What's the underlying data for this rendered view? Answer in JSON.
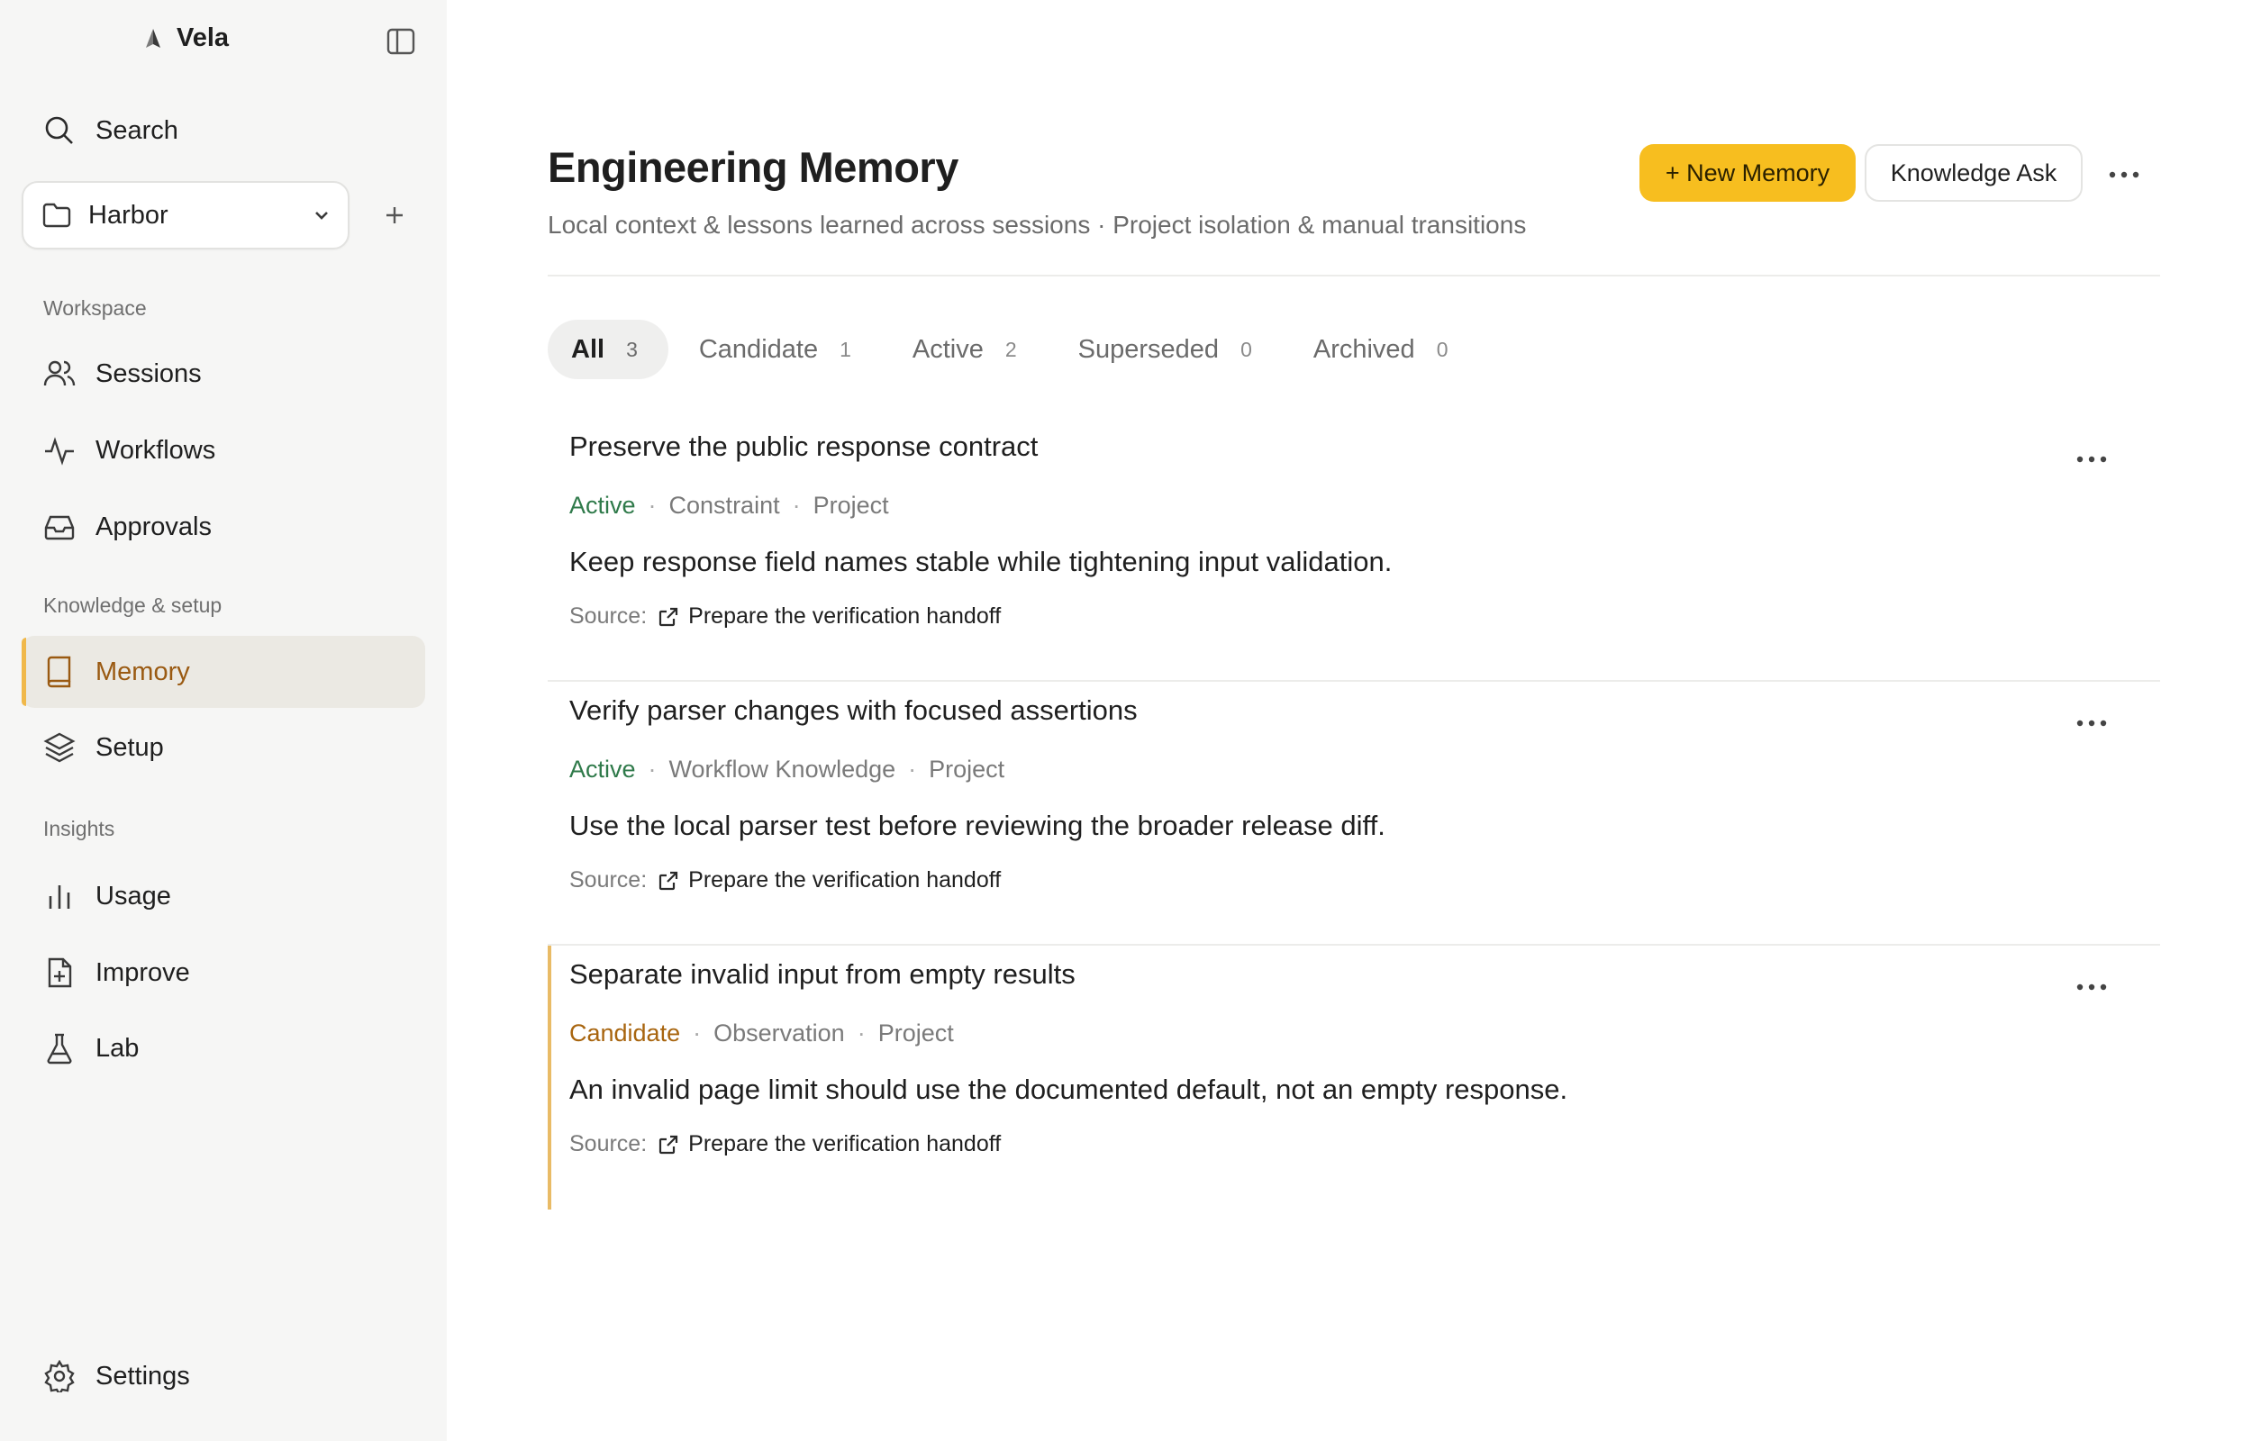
{
  "sidebar": {
    "app_name": "Vela",
    "search_label": "Search",
    "project": "Harbor",
    "sections": {
      "workspace": "Workspace",
      "knowledge": "Knowledge & setup",
      "insights": "Insights"
    },
    "items": {
      "sessions": "Sessions",
      "workflows": "Workflows",
      "approvals": "Approvals",
      "memory": "Memory",
      "setup": "Setup",
      "usage": "Usage",
      "improve": "Improve",
      "lab": "Lab"
    },
    "settings_label": "Settings"
  },
  "header": {
    "title": "Engineering Memory",
    "subtitle": "Local context & lessons learned across sessions · Project isolation & manual transitions",
    "new_memory_label": "+ New Memory",
    "knowledge_ask_label": "Knowledge Ask"
  },
  "tabs": [
    {
      "label": "All",
      "count": "3"
    },
    {
      "label": "Candidate",
      "count": "1"
    },
    {
      "label": "Active",
      "count": "2"
    },
    {
      "label": "Superseded",
      "count": "0"
    },
    {
      "label": "Archived",
      "count": "0"
    }
  ],
  "memories": [
    {
      "title": "Preserve the public response contract",
      "status": "Active",
      "type": "Constraint",
      "scope": "Project",
      "body": "Keep response field names stable while tightening input validation.",
      "source_label": "Source:",
      "source_link": "Prepare the verification handoff"
    },
    {
      "title": "Verify parser changes with focused assertions",
      "status": "Active",
      "type": "Workflow Knowledge",
      "scope": "Project",
      "body": "Use the local parser test before reviewing the broader release diff.",
      "source_label": "Source:",
      "source_link": "Prepare the verification handoff"
    },
    {
      "title": "Separate invalid input from empty results",
      "status": "Candidate",
      "type": "Observation",
      "scope": "Project",
      "body": "An invalid page limit should use the documented default, not an empty response.",
      "source_label": "Source:",
      "source_link": "Prepare the verification handoff"
    }
  ],
  "colors": {
    "accent": "#f7be1f",
    "active_status": "#2f7a4a",
    "candidate_status": "#a8650f",
    "sidebar_active_bg": "#ebe9e3"
  }
}
